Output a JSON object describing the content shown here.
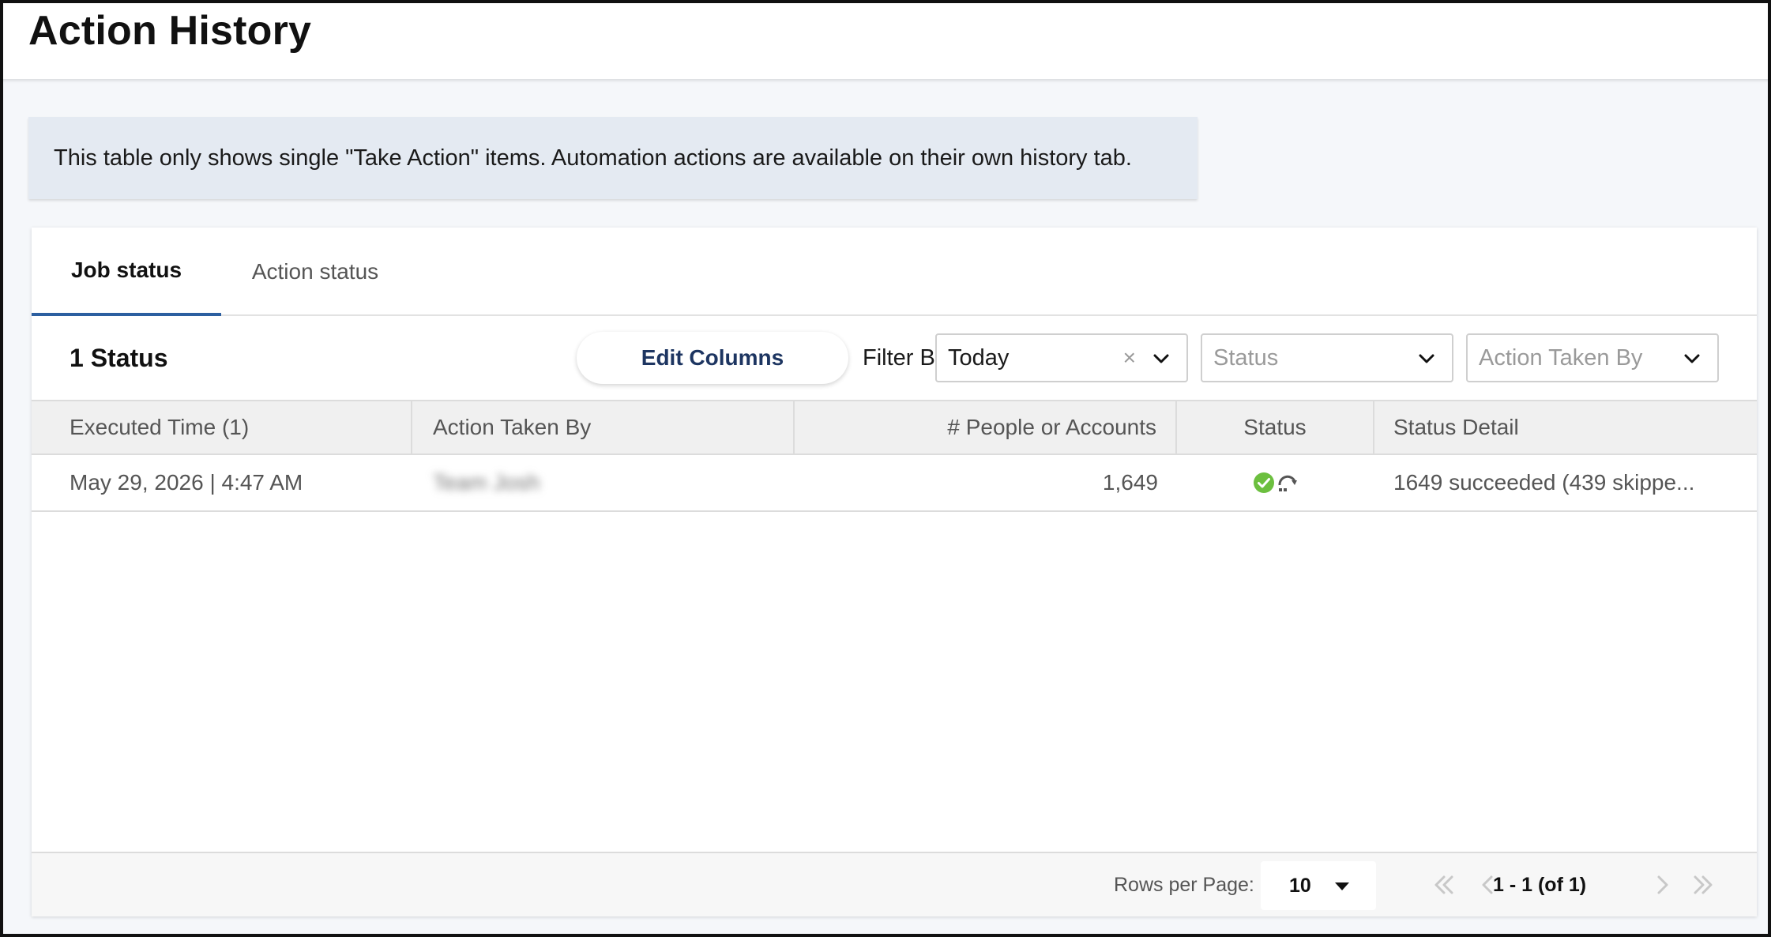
{
  "header": {
    "title": "Action History"
  },
  "banner": {
    "text": "This table only shows single \"Take Action\" items. Automation actions are available on their own history tab."
  },
  "tabs": [
    {
      "label": "Job status",
      "active": true
    },
    {
      "label": "Action status",
      "active": false
    }
  ],
  "toolbar": {
    "status_count": "1 Status",
    "edit_columns_label": "Edit Columns",
    "filter_label": "Filter By:",
    "filters": [
      {
        "value": "Today",
        "placeholder": "",
        "clearable": true
      },
      {
        "value": "",
        "placeholder": "Status"
      },
      {
        "value": "",
        "placeholder": "Action Taken By"
      }
    ],
    "clear_glyph": "×"
  },
  "table": {
    "columns": [
      "Executed Time (1)",
      "Action Taken By",
      "# People or Accounts",
      "Status",
      "Status Detail"
    ],
    "rows": [
      {
        "executed_time": "May 29, 2026 | 4:47 AM",
        "action_taken_by": "Team Josh",
        "people_or_accounts": "1,649",
        "status_icons": [
          "check-circle-icon",
          "sync-icon"
        ],
        "status_detail": "1649 succeeded (439 skippe..."
      }
    ]
  },
  "pagination": {
    "rows_per_page_label": "Rows per Page:",
    "rows_per_page_value": "10",
    "range": "1 - 1 (of 1)"
  },
  "colors": {
    "accent": "#2c5fa0",
    "success": "#6cbf3f",
    "banner_bg": "#e4eaf2",
    "button_text": "#1d3561"
  }
}
